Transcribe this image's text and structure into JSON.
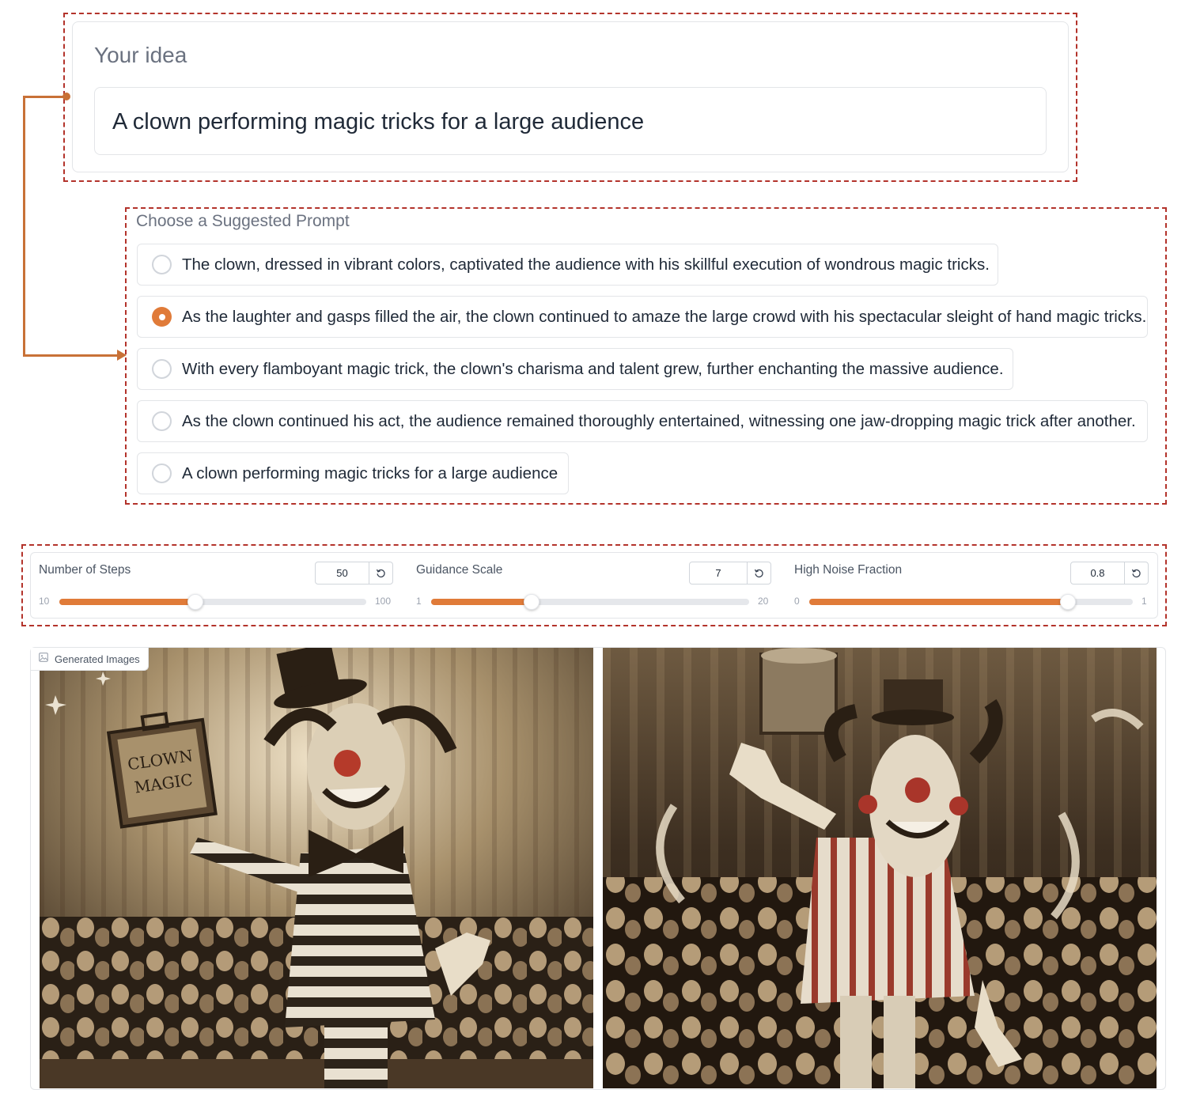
{
  "idea": {
    "label": "Your idea",
    "value": "A clown performing magic tricks for a large audience"
  },
  "prompts": {
    "label": "Choose a Suggested Prompt",
    "selected_index": 1,
    "options": [
      "The clown, dressed in vibrant colors, captivated the audience with his skillful execution of wondrous magic tricks.",
      "As the laughter and gasps filled the air, the clown continued to amaze the large crowd with his spectacular sleight of hand magic tricks.",
      "With every flamboyant magic trick, the clown's charisma and talent grew, further enchanting the massive audience.",
      "As the clown continued his act, the audience remained thoroughly entertained, witnessing one jaw-dropping magic trick after another.",
      "A clown performing magic tricks for a large audience"
    ]
  },
  "sliders": [
    {
      "label": "Number of Steps",
      "value": "50",
      "min": "10",
      "max": "100",
      "fraction": 0.444
    },
    {
      "label": "Guidance Scale",
      "value": "7",
      "min": "1",
      "max": "20",
      "fraction": 0.316
    },
    {
      "label": "High Noise Fraction",
      "value": "0.8",
      "min": "0",
      "max": "1",
      "fraction": 0.8
    }
  ],
  "gallery": {
    "label": "Generated Images",
    "images": [
      {
        "sign_lines": [
          "CLOWN",
          "MAGIC"
        ]
      },
      {}
    ]
  },
  "colors": {
    "accent": "#e07b39",
    "highlight_dash": "#b3332b",
    "connector": "#c87137"
  },
  "icons": [
    "reset-icon",
    "image-icon",
    "radio-icon"
  ]
}
